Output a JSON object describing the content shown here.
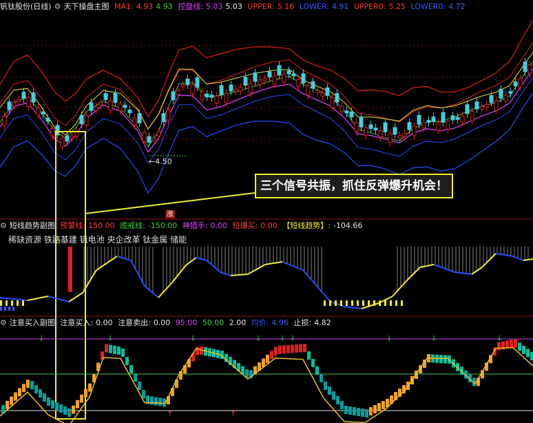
{
  "main_panel": {
    "title": "钒钛股份(日线)",
    "indicator": "天下操盘主图",
    "ma1": {
      "label": "MA1:",
      "value": "4.93",
      "value2": "4.93",
      "color": "#ff3d3d"
    },
    "kongpan": {
      "label": "控盘线:",
      "value": "5.03",
      "value2": "5.03",
      "color": "#e040ff"
    },
    "upper": {
      "label": "UPPER:",
      "value": "5.16",
      "color": "#ff3d3d"
    },
    "lower": {
      "label": "LOWER:",
      "value": "4.91",
      "color": "#3a5bff"
    },
    "upper0": {
      "label": "UPPER0:",
      "value": "5.25",
      "color": "#ff3d3d"
    },
    "lower0": {
      "label": "LOWER0:",
      "value": "4.72",
      "color": "#3a5bff"
    },
    "low_marker": "4.50",
    "badge": "涨"
  },
  "annotation": "三个信号共振，抓住反弹爆升机会！",
  "mid_panel": {
    "name": "短线趋势副图",
    "alert": {
      "label": "预警线:",
      "value": "150.00"
    },
    "bottom": {
      "label": "底戒线:",
      "value": "-150.00"
    },
    "hunter": {
      "label": "神猎手:",
      "value": "0.00"
    },
    "explode": {
      "label": "短爆买:",
      "value": "0.00"
    },
    "trend": {
      "label": "【短线趋势】:",
      "value": "-104.66"
    },
    "concepts": "稀缺资源 铁路基建 钒电池 央企改革 钛金属 储能"
  },
  "bottom_panel": {
    "name": "注意买入副图",
    "buy": {
      "label": "注意买入:",
      "value": "0.00"
    },
    "sell": {
      "label": "注意卖出:",
      "value": "0.00"
    },
    "v95": "95.00",
    "v50": "50.00",
    "v2": "2.00",
    "avg": {
      "label": "均价:",
      "value": "4.96"
    },
    "stop": {
      "label": "止损:",
      "value": "4.82"
    }
  },
  "chart_data": {
    "type": "candlestick",
    "series": [
      {
        "name": "MA1",
        "color": "#ff3d3d"
      },
      {
        "name": "控盘线",
        "color": "#e040ff"
      },
      {
        "name": "UPPER",
        "color": "#ff3d3d"
      },
      {
        "name": "LOWER",
        "color": "#3a5bff"
      },
      {
        "name": "UPPER0",
        "color": "#ff3d3d"
      },
      {
        "name": "LOWER0",
        "color": "#3a5bff"
      }
    ],
    "annotations": [
      "4.50",
      "涨"
    ]
  }
}
